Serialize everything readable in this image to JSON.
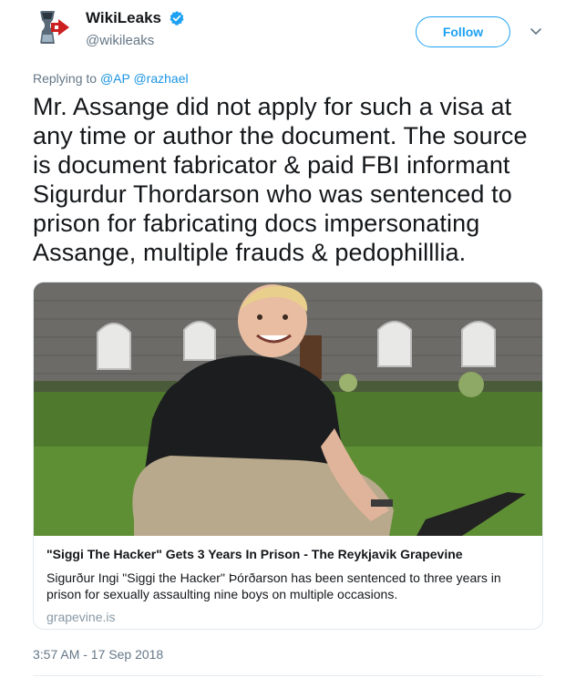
{
  "author": {
    "display_name": "WikiLeaks",
    "handle": "@wikileaks",
    "avatar_icon": "hourglass-logo-icon",
    "verified_icon": "verified-badge-icon"
  },
  "actions": {
    "follow_label": "Follow",
    "more_icon": "chevron-down-icon"
  },
  "reply": {
    "prefix": "Replying to",
    "mentions": [
      "@AP",
      "@razhael"
    ]
  },
  "tweet": {
    "lines": [
      "Mr. Assange did not apply for such a visa at",
      "any time or author the document. The source",
      "is document fabricator & paid FBI informant",
      "Sigurdur Thordarson who was sentenced to",
      "prison for fabricating docs impersonating",
      "Assange, multiple frauds & pedophilllia."
    ]
  },
  "card": {
    "title": "\"Siggi The Hacker\" Gets 3 Years In Prison - The Reykjavik Grapevine",
    "description_lines": [
      "Sigurður Ingi \"Siggi the Hacker\" Þórðarson has been sentenced to three years in",
      "prison for sexually assaulting nine boys on multiple occasions."
    ],
    "domain": "grapevine.is"
  },
  "timestamp": "3:57 AM - 17 Sep 2018",
  "colors": {
    "accent": "#1da1f2",
    "mention": "#1b95e0",
    "secondary_text": "#657786"
  }
}
